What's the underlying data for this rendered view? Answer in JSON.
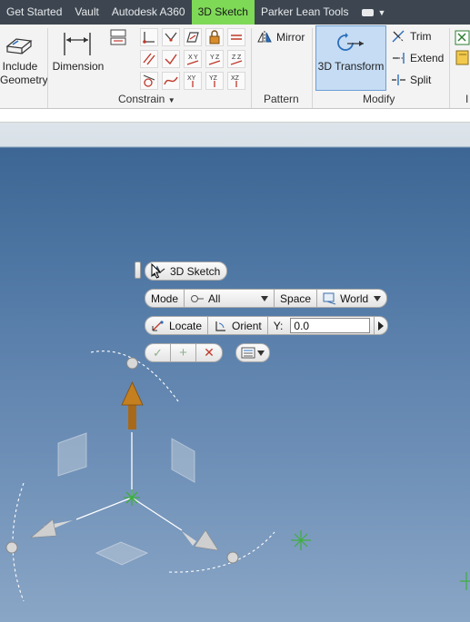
{
  "tabs": [
    {
      "label": "Get Started",
      "active": false
    },
    {
      "label": "Vault",
      "active": false
    },
    {
      "label": "Autodesk A360",
      "active": false
    },
    {
      "label": "3D Sketch",
      "active": true
    },
    {
      "label": "Parker Lean Tools",
      "active": false
    }
  ],
  "ribbon": {
    "include_geometry_label": "Include\nGeometry",
    "dimension_label": "Dimension",
    "panels": {
      "constrain": "Constrain",
      "pattern": "Pattern",
      "modify": "Modify"
    },
    "mirror_label": "Mirror",
    "transform_label": "3D Transform",
    "trim_label": "Trim",
    "extend_label": "Extend",
    "split_label": "Split",
    "cut_label": "I"
  },
  "minitoolbar": {
    "title": "3D Sketch",
    "mode_label": "Mode",
    "mode_value": "All",
    "space_label": "Space",
    "space_value": "World",
    "locate_label": "Locate",
    "orient_label": "Orient",
    "axis_label": "Y:",
    "axis_value": "0.0"
  },
  "colors": {
    "tab_active": "#7ed957",
    "tabbar": "#3d4650",
    "arrow": "#b8741a",
    "cancel": "#c0392b",
    "ok": "#7f9f7f"
  }
}
